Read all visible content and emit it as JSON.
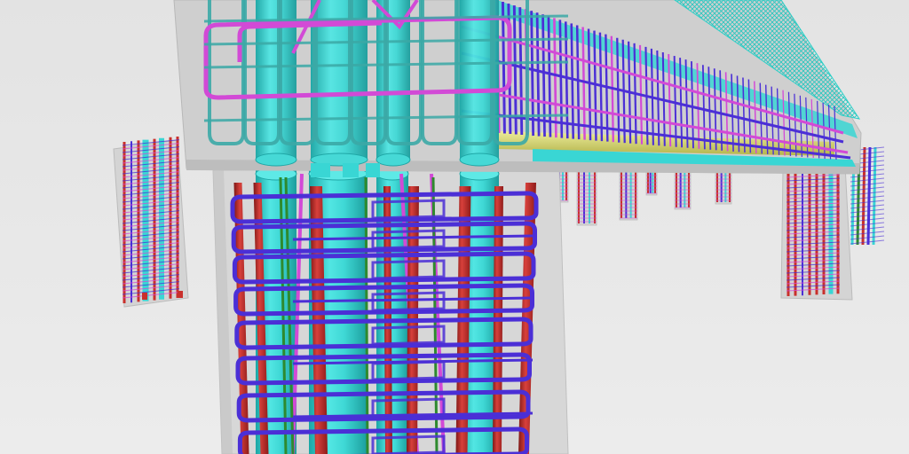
{
  "view": {
    "type": "3d-rebar-model-viewport",
    "colors": {
      "background_top": "#e3e3e3",
      "background_bottom": "#ececec",
      "concrete": "#c9c9c9",
      "concrete_edge": "#b5b5b5",
      "main_bar_cyan": "#39d6d4",
      "main_bar_cyan_dark": "#1fa7a6",
      "longitudinal_red": "#c9302c",
      "longitudinal_red_dark": "#8e1c1a",
      "stirrup_blue": "#4b2fd6",
      "stirrup_magenta": "#d24ad6",
      "stirrup_teal": "#3ba9a6",
      "bar_green": "#2e8a2e",
      "bar_yellow": "#d8d86a",
      "mesh_cyan": "#2fd0c8"
    },
    "objects": [
      "beam-cap",
      "front-column",
      "left-distant-column",
      "right-distant-column",
      "mid-distant-columns"
    ]
  }
}
